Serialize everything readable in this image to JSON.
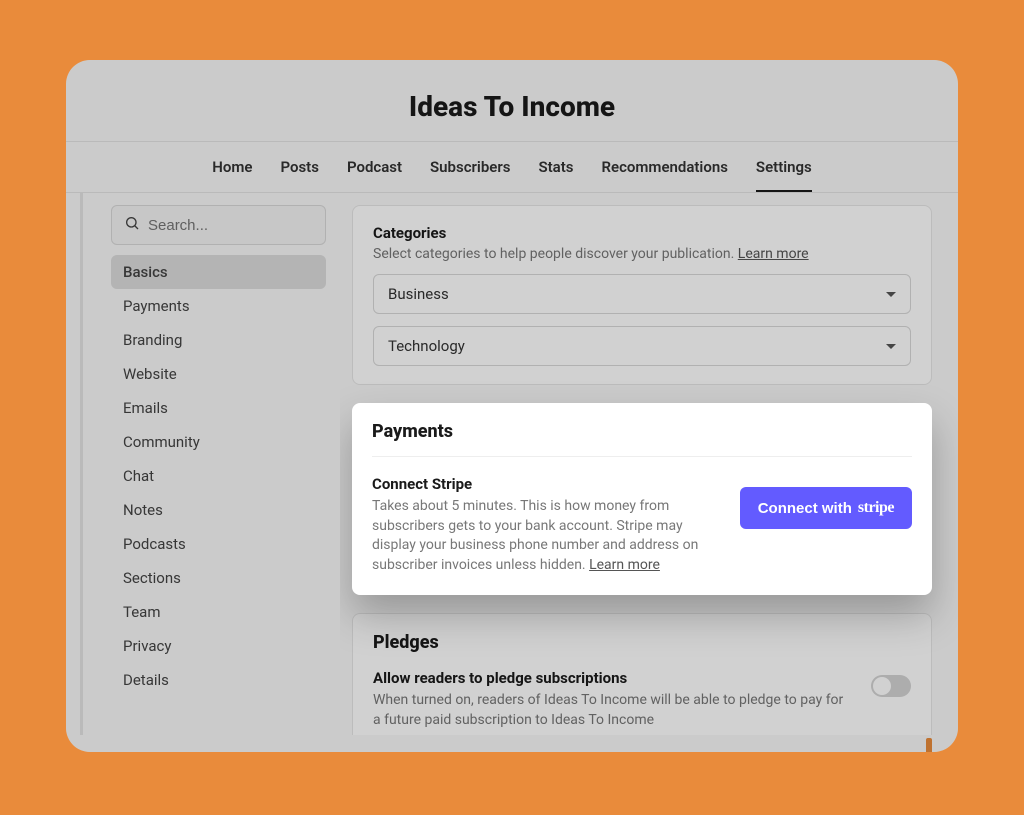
{
  "header": {
    "title": "Ideas To Income"
  },
  "nav": {
    "items": [
      "Home",
      "Posts",
      "Podcast",
      "Subscribers",
      "Stats",
      "Recommendations",
      "Settings"
    ],
    "active": "Settings"
  },
  "search": {
    "placeholder": "Search..."
  },
  "sidebar": {
    "items": [
      "Basics",
      "Payments",
      "Branding",
      "Website",
      "Emails",
      "Community",
      "Chat",
      "Notes",
      "Podcasts",
      "Sections",
      "Team",
      "Privacy",
      "Details"
    ],
    "active": "Basics"
  },
  "categories": {
    "title": "Categories",
    "desc": "Select categories to help people discover your publication. ",
    "learn_more": "Learn more",
    "selected": [
      "Business",
      "Technology"
    ]
  },
  "payments": {
    "heading": "Payments",
    "connect_title": "Connect Stripe",
    "connect_desc": "Takes about 5 minutes. This is how money from subscribers gets to your bank account. Stripe may display your business phone number and address on subscriber invoices unless hidden. ",
    "learn_more": "Learn more",
    "button_label": "Connect with ",
    "button_brand": "stripe"
  },
  "pledges": {
    "heading": "Pledges",
    "title": "Allow readers to pledge subscriptions",
    "desc": "When turned on, readers of Ideas To Income will be able to pledge to pay for a future paid subscription to Ideas To Income",
    "enabled": false
  },
  "colors": {
    "accent": "#635bff",
    "bg": "#e98b3b"
  }
}
